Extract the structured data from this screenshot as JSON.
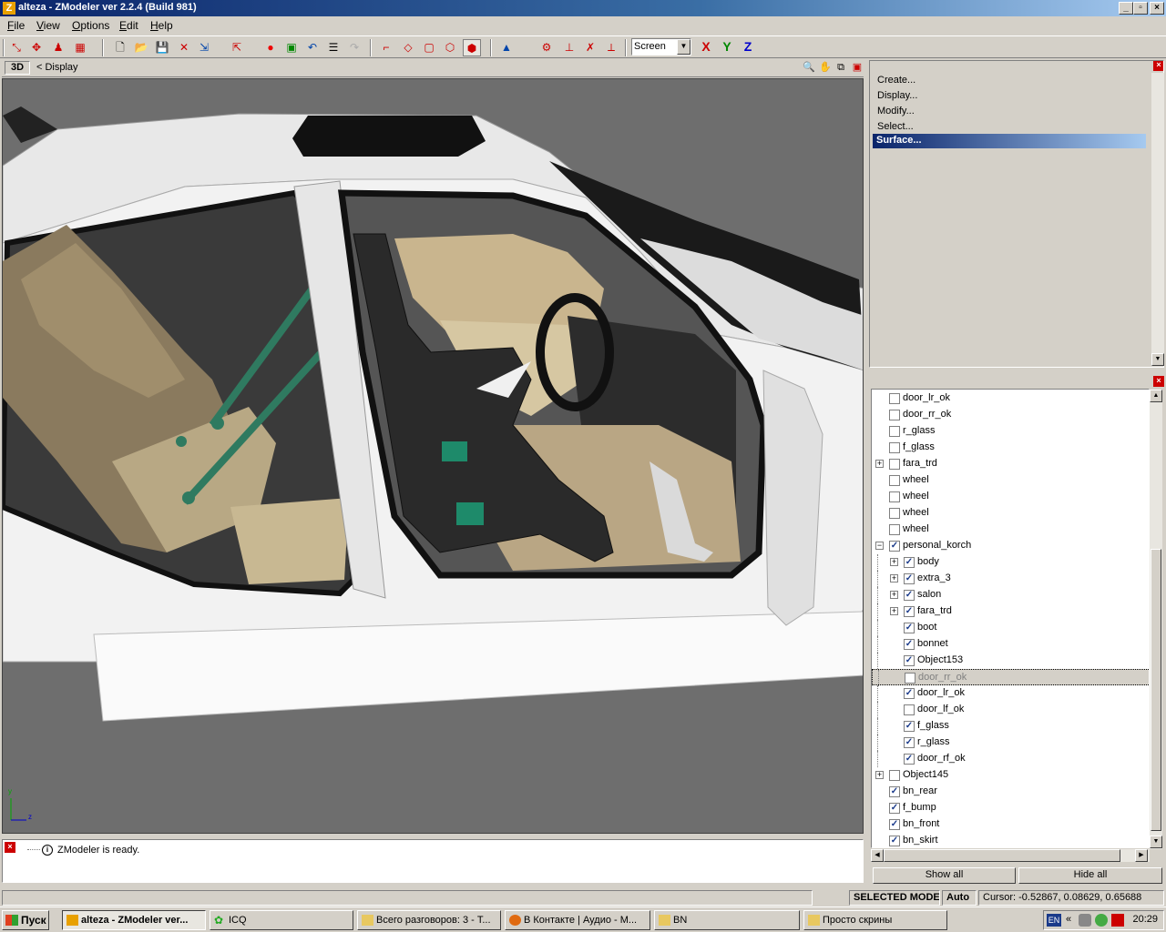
{
  "window": {
    "title": "alteza - ZModeler ver 2.2.4 (Build 981)",
    "app_icon": "Z"
  },
  "menu": [
    "File",
    "View",
    "Options",
    "Edit",
    "Help"
  ],
  "toolbar": {
    "coord_system": "Screen",
    "axes": [
      "X",
      "Y",
      "Z"
    ],
    "axis_colors": [
      "#cc0000",
      "#008000",
      "#0000cc"
    ]
  },
  "viewport": {
    "mode": "3D",
    "breadcrumb": "<  Display",
    "gizmo_labels": {
      "y": "y",
      "z": "z"
    }
  },
  "command_panel": {
    "items": [
      "Create...",
      "Display...",
      "Modify...",
      "Select..."
    ],
    "selected": "Surface..."
  },
  "tree": [
    {
      "label": "door_lr_ok",
      "checked": false,
      "level": 0,
      "expander": ""
    },
    {
      "label": "door_rr_ok",
      "checked": false,
      "level": 0,
      "expander": ""
    },
    {
      "label": "r_glass",
      "checked": false,
      "level": 0,
      "expander": ""
    },
    {
      "label": "f_glass",
      "checked": false,
      "level": 0,
      "expander": ""
    },
    {
      "label": "fara_trd",
      "checked": false,
      "level": 0,
      "expander": "+"
    },
    {
      "label": "wheel",
      "checked": false,
      "level": 0,
      "expander": ""
    },
    {
      "label": "wheel",
      "checked": false,
      "level": 0,
      "expander": ""
    },
    {
      "label": "wheel",
      "checked": false,
      "level": 0,
      "expander": ""
    },
    {
      "label": "wheel",
      "checked": false,
      "level": 0,
      "expander": ""
    },
    {
      "label": "personal_korch",
      "checked": true,
      "level": 0,
      "expander": "−"
    },
    {
      "label": "body",
      "checked": true,
      "level": 1,
      "expander": "+"
    },
    {
      "label": "extra_3",
      "checked": true,
      "level": 1,
      "expander": "+"
    },
    {
      "label": "salon",
      "checked": true,
      "level": 1,
      "expander": "+"
    },
    {
      "label": "fara_trd",
      "checked": true,
      "level": 1,
      "expander": "+"
    },
    {
      "label": "boot",
      "checked": true,
      "level": 1,
      "expander": ""
    },
    {
      "label": "bonnet",
      "checked": true,
      "level": 1,
      "expander": ""
    },
    {
      "label": "Object153",
      "checked": true,
      "level": 1,
      "expander": ""
    },
    {
      "label": "door_rr_ok",
      "checked": false,
      "level": 1,
      "expander": "",
      "highlighted": true
    },
    {
      "label": "door_lr_ok",
      "checked": true,
      "level": 1,
      "expander": ""
    },
    {
      "label": "door_lf_ok",
      "checked": false,
      "level": 1,
      "expander": ""
    },
    {
      "label": "f_glass",
      "checked": true,
      "level": 1,
      "expander": ""
    },
    {
      "label": "r_glass",
      "checked": true,
      "level": 1,
      "expander": ""
    },
    {
      "label": "door_rf_ok",
      "checked": true,
      "level": 1,
      "expander": ""
    },
    {
      "label": "Object145",
      "checked": false,
      "level": 0,
      "expander": "+"
    },
    {
      "label": "bn_rear",
      "checked": true,
      "level": 0,
      "expander": ""
    },
    {
      "label": "f_bump",
      "checked": true,
      "level": 0,
      "expander": ""
    },
    {
      "label": "bn_front",
      "checked": true,
      "level": 0,
      "expander": ""
    },
    {
      "label": "bn_skirt",
      "checked": true,
      "level": 0,
      "expander": ""
    }
  ],
  "buttons": {
    "show_all": "Show all",
    "hide_all": "Hide all"
  },
  "log": {
    "message": "ZModeler is ready."
  },
  "status": {
    "mode": "SELECTED MODE",
    "auto": "Auto",
    "cursor": "Cursor: -0.52867, 0.08629, 0.65688"
  },
  "taskbar": {
    "start": "Пуск",
    "tasks": [
      "alteza - ZModeler ver...",
      "ICQ",
      "Всего разговоров: 3 - Т...",
      "В Контакте | Аудио - М...",
      "BN",
      "Просто скрины"
    ],
    "lang": "EN",
    "clock": "20:29"
  }
}
